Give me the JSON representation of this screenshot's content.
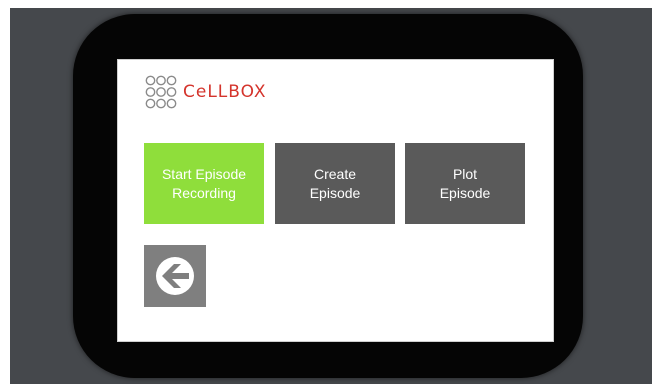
{
  "logo": {
    "text": "CeLLBOX"
  },
  "tiles": [
    {
      "label": "Start Episode\nRecording"
    },
    {
      "label": "Create\nEpisode"
    },
    {
      "label": "Plot\nEpisode"
    }
  ],
  "back_button": {
    "icon": "arrow-left-circle-icon"
  },
  "colors": {
    "active_tile": "#8fde3b",
    "tile": "#5a5a5a",
    "logo_text": "#d4342c",
    "bezel": "#050505",
    "backdrop": "#45484c"
  }
}
